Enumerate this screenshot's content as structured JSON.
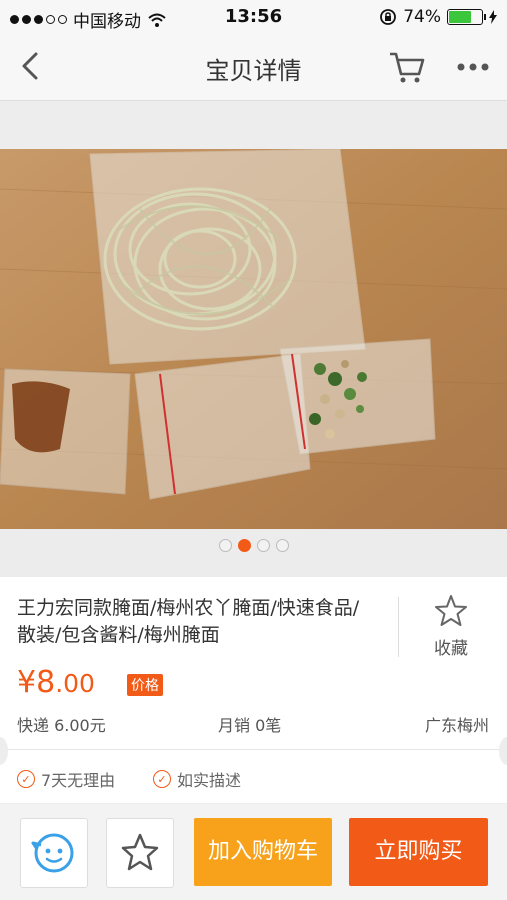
{
  "status": {
    "carrier": "中国移动",
    "time": "13:56",
    "battery": "74%",
    "battery_level": 0.74
  },
  "nav": {
    "title": "宝贝详情"
  },
  "gallery": {
    "page_count": 4,
    "active_index": 1
  },
  "product": {
    "title": "王力宏同款腌面/梅州农丫腌面/快速食品/散装/包含酱料/梅州腌面",
    "favorite_label": "收藏",
    "price_symbol": "¥",
    "price_int": "8",
    "price_dec": ".00",
    "price_tag": "价格",
    "shipping": "快递 6.00元",
    "monthly_sales": "月销 0笔",
    "location": "广东梅州",
    "promises": [
      "7天无理由",
      "如实描述"
    ]
  },
  "actions": {
    "add_to_cart": "加入购物车",
    "buy_now": "立即购买"
  },
  "colors": {
    "accent": "#f25a17",
    "cart_button": "#f7a21a"
  }
}
